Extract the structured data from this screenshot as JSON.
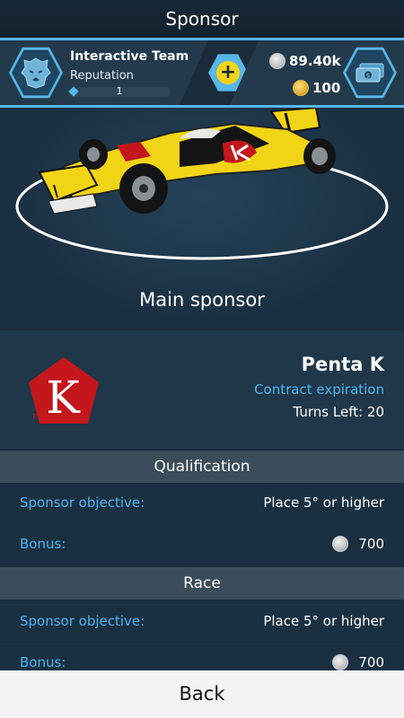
{
  "screen": {
    "title": "Sponsor"
  },
  "team": {
    "name": "Interactive Team",
    "reputation_label": "Reputation",
    "reputation_level": "1",
    "emblem_icon": "lion-icon"
  },
  "currency": {
    "silver": "89.40k",
    "gold": "100",
    "shop_icon": "cash-icon",
    "add_icon": "plus-icon"
  },
  "main_sponsor_title": "Main sponsor",
  "sponsor": {
    "name": "Penta K",
    "logo_caption": "PENTA K",
    "logo_letter": "K",
    "contract_label": "Contract expiration",
    "turns_left": "Turns Left: 20"
  },
  "sections": [
    {
      "title": "Qualification",
      "objective_label": "Sponsor objective:",
      "objective_value": "Place 5° or higher",
      "bonus_label": "Bonus:",
      "bonus_value": "700"
    },
    {
      "title": "Race",
      "objective_label": "Sponsor objective:",
      "objective_value": "Place 5° or higher",
      "bonus_label": "Bonus:",
      "bonus_value": "700"
    }
  ],
  "back_label": "Back",
  "colors": {
    "accent": "#58b6e8",
    "label_blue": "#4db4ef",
    "car_yellow": "#f2d416",
    "sponsor_red": "#c3171c"
  }
}
